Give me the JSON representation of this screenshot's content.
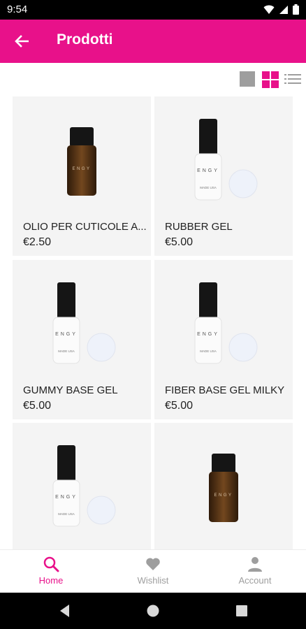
{
  "status_bar": {
    "time": "9:54"
  },
  "app_bar": {
    "title": "Prodotti"
  },
  "products": [
    {
      "name": "OLIO PER CUTICOLE A...",
      "price": "€2.50",
      "kind": "oil"
    },
    {
      "name": "RUBBER GEL",
      "price": "€5.00",
      "kind": "gel"
    },
    {
      "name": "GUMMY BASE GEL",
      "price": "€5.00",
      "kind": "gel"
    },
    {
      "name": "FIBER BASE GEL MILKY",
      "price": "€5.00",
      "kind": "gel"
    },
    {
      "name": "",
      "price": "",
      "kind": "gel"
    },
    {
      "name": "",
      "price": "",
      "kind": "oil"
    }
  ],
  "bottle_brand": "ENGY",
  "bottle_sub": "MADE USA",
  "bottom_nav": {
    "items": [
      {
        "label": "Home",
        "icon": "search-icon",
        "active": true
      },
      {
        "label": "Wishlist",
        "icon": "heart-icon",
        "active": false
      },
      {
        "label": "Account",
        "icon": "person-icon",
        "active": false
      }
    ]
  },
  "colors": {
    "accent": "#e8118a",
    "status_bar": "#000000",
    "card_bg": "#f4f4f4",
    "inactive": "#9e9e9e"
  }
}
